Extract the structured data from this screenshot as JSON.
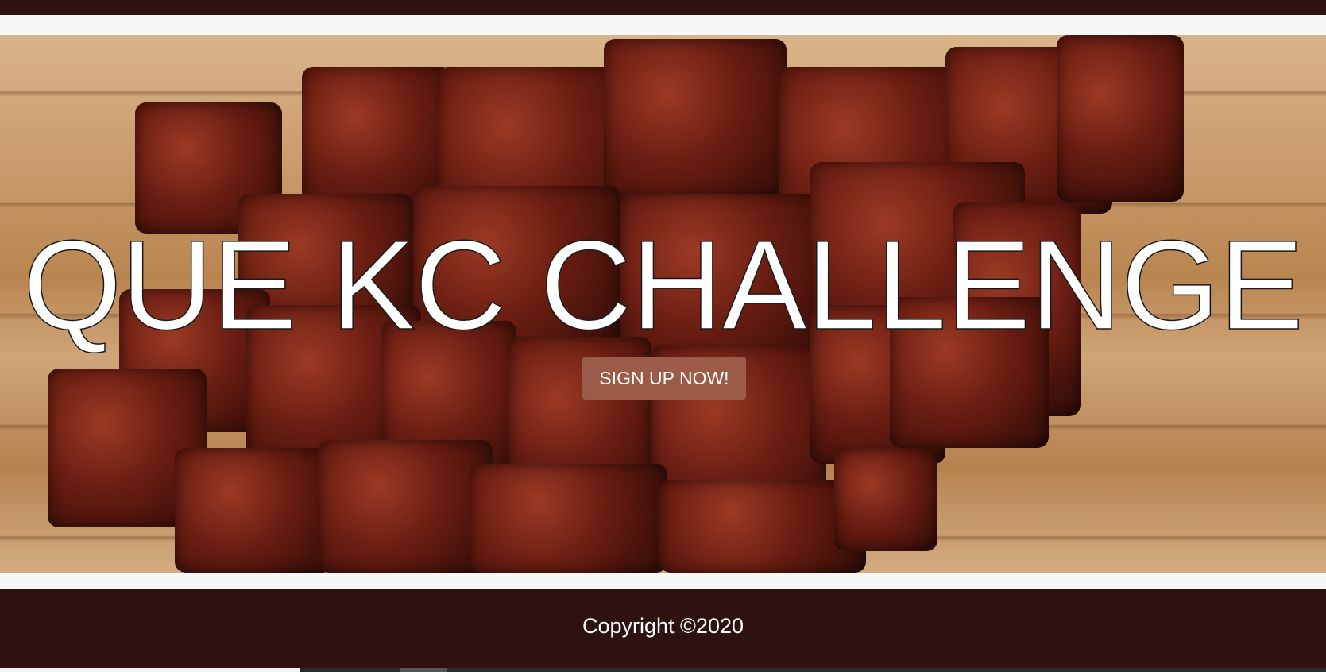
{
  "hero": {
    "title": "QUE KC CHALLENGE",
    "background_image": "bbq-burnt-ends-photo",
    "signup_button_label": "SIGN UP NOW!"
  },
  "footer": {
    "copyright": "Copyright ©2020"
  },
  "colors": {
    "header_footer_bg": "#2d1210",
    "button_bg": "#9c5a48",
    "text": "#ffffff"
  }
}
